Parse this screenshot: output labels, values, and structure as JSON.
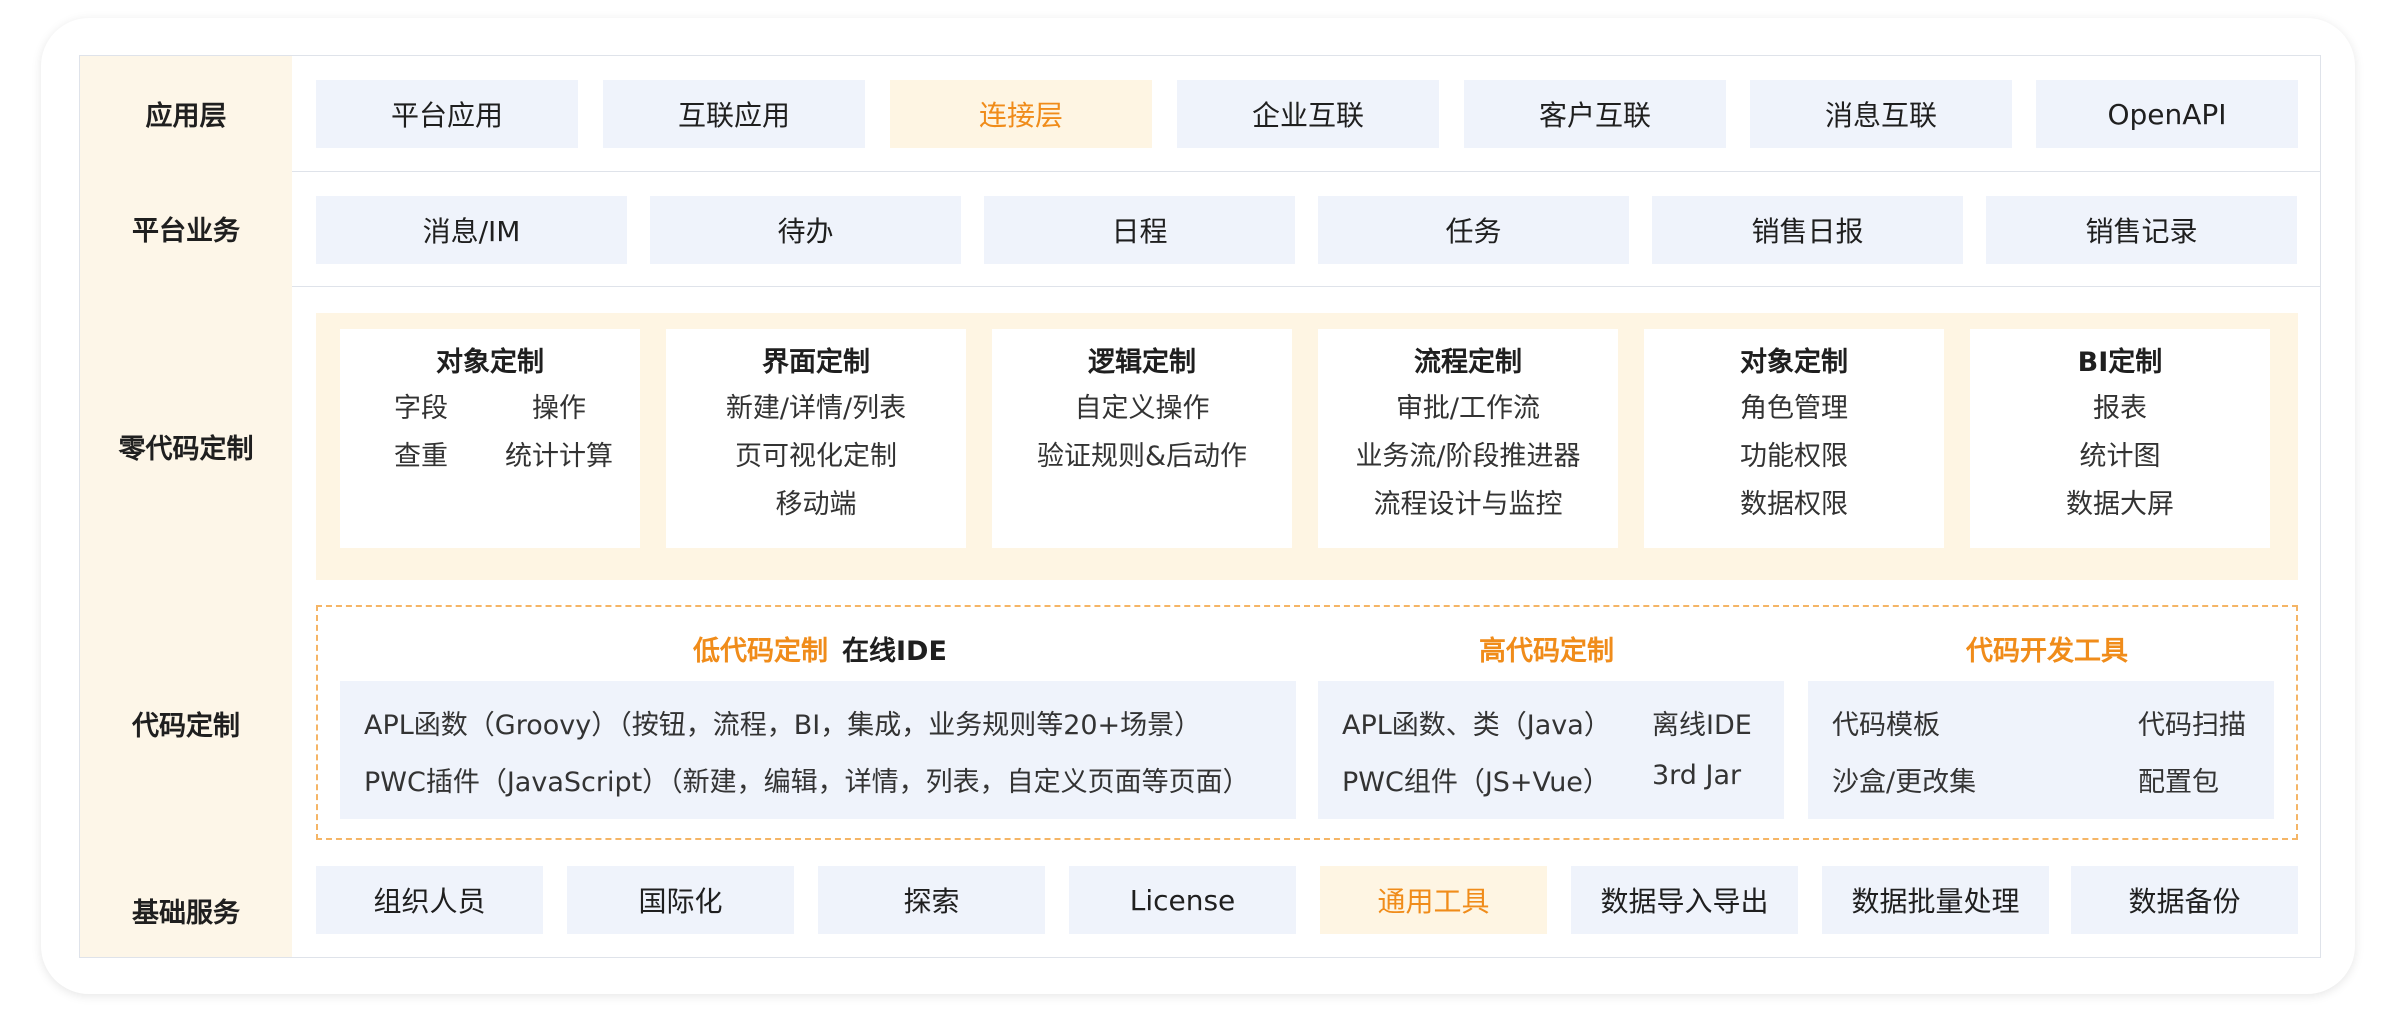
{
  "layers": {
    "app": "应用层",
    "platform": "平台业务",
    "zero_code": "零代码定制",
    "code": "代码定制",
    "base": "基础服务"
  },
  "app_items": [
    "平台应用",
    "互联应用",
    "连接层",
    "企业互联",
    "客户互联",
    "消息互联",
    "OpenAPI"
  ],
  "platform_items": [
    "消息/IM",
    "待办",
    "日程",
    "任务",
    "销售日报",
    "销售记录"
  ],
  "zero_cards": [
    {
      "title": "对象定制",
      "grid": [
        "字段",
        "操作",
        "查重",
        "统计计算"
      ]
    },
    {
      "title": "界面定制",
      "lines": [
        "新建/详情/列表",
        "页可视化定制",
        "移动端"
      ]
    },
    {
      "title": "逻辑定制",
      "lines": [
        "自定义操作",
        "验证规则&后动作"
      ]
    },
    {
      "title": "流程定制",
      "lines": [
        "审批/工作流",
        "业务流/阶段推进器",
        "流程设计与监控"
      ]
    },
    {
      "title": "对象定制",
      "lines": [
        "角色管理",
        "功能权限",
        "数据权限"
      ]
    },
    {
      "title": "BI定制",
      "lines": [
        "报表",
        "统计图",
        "数据大屏"
      ]
    }
  ],
  "code": {
    "low": {
      "title": "低代码定制",
      "sub": "在线IDE",
      "lines": [
        "APL函数（Groovy）（按钮，流程，BI，集成，业务规则等20+场景）",
        "PWC插件（JavaScript）（新建，编辑，详情，列表，自定义页面等页面）"
      ]
    },
    "high": {
      "title": "高代码定制",
      "left": [
        "APL函数、类（Java）",
        "PWC组件（JS+Vue）"
      ],
      "right": [
        "离线IDE",
        "3rd Jar"
      ]
    },
    "tools": {
      "title": "代码开发工具",
      "left": [
        "代码模板",
        "沙盒/更改集"
      ],
      "right": [
        "代码扫描",
        "配置包"
      ]
    }
  },
  "base_items": [
    "组织人员",
    "国际化",
    "探索",
    "License",
    "通用工具",
    "数据导入导出",
    "数据批量处理",
    "数据备份"
  ],
  "colors": {
    "accent": "#f08c1a",
    "chip_bg": "#eff3fb",
    "highlight_bg": "#fef5e3",
    "side_bg": "#fdf6e8"
  }
}
